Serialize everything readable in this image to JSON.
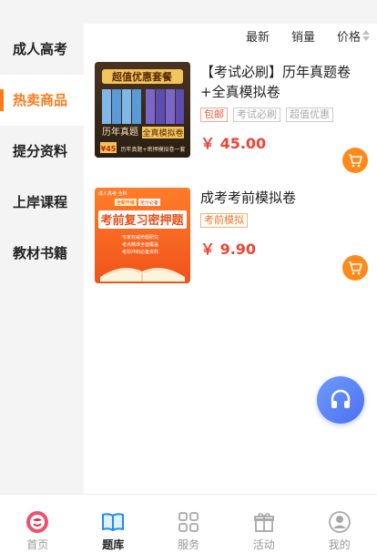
{
  "sidebar": {
    "items": [
      {
        "label": "成人高考"
      },
      {
        "label": "热卖商品"
      },
      {
        "label": "提分资料"
      },
      {
        "label": "上岸课程"
      },
      {
        "label": "教材书籍"
      }
    ],
    "active_index": 1
  },
  "sort": {
    "latest": "最新",
    "sales": "销量",
    "price": "价格"
  },
  "products": [
    {
      "title": "【考试必刷】历年真题卷+全真模拟卷",
      "tags": [
        "包邮",
        "考试必刷",
        "超值优惠"
      ],
      "price": "￥ 45.00",
      "cover": {
        "banner": "超值优惠套餐",
        "label_left": "历年真题",
        "label_right": "全真模拟卷",
        "price_tag": "¥45",
        "strip": "历年真题+密押模拟卷一套"
      }
    },
    {
      "title": "成考考前模拟卷",
      "tags": [
        "考前模拟"
      ],
      "price": "￥ 9.90",
      "cover": {
        "chip_left": "成人高考·全科",
        "chip_mid": "全新升级",
        "chip_right": "抢分必备",
        "headline": "考前复习密押题",
        "line1": "专家权威命题研究",
        "line2": "考点精准全面覆盖",
        "line3": "考前冲刺必备资料"
      }
    }
  ],
  "tabbar": {
    "items": [
      {
        "label": "首页",
        "icon": "home-logo-icon"
      },
      {
        "label": "题库",
        "icon": "open-book-icon"
      },
      {
        "label": "服务",
        "icon": "grid-icon"
      },
      {
        "label": "活动",
        "icon": "gift-icon"
      },
      {
        "label": "我的",
        "icon": "user-icon"
      }
    ],
    "active_index": 1
  },
  "colors": {
    "accent": "#ff7a1a",
    "price": "#ee4433",
    "fab": "#5b7ff6"
  }
}
